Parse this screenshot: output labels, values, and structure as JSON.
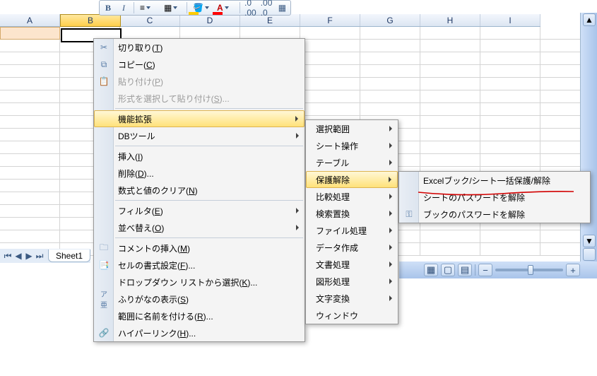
{
  "columns": [
    "A",
    "B",
    "C",
    "D",
    "E",
    "F",
    "G",
    "H",
    "I"
  ],
  "toolbar": {
    "bold": "B",
    "italic": "I",
    "increase_decimal": ".00",
    "decrease_decimal": ".0"
  },
  "selected_col_header": "B",
  "context_menu": {
    "cut": "切り取り(T)",
    "copy": "コピー(C)",
    "paste": "貼り付け(P)",
    "paste_special": "形式を選択して貼り付け(S)...",
    "extensions": "機能拡張",
    "db_tools": "DBツール",
    "insert": "挿入(I)",
    "delete": "削除(D)...",
    "clear": "数式と値のクリア(N)",
    "filter": "フィルタ(E)",
    "sort": "並べ替え(O)",
    "insert_comment": "コメントの挿入(M)",
    "format_cells": "セルの書式設定(F)...",
    "dropdown": "ドロップダウン リストから選択(K)...",
    "phonetic": "ふりがなの表示(S)",
    "define_name": "範囲に名前を付ける(R)...",
    "hyperlink": "ハイパーリンク(H)..."
  },
  "sub_menu": {
    "selection": "選択範囲",
    "sheet_ops": "シート操作",
    "table": "テーブル",
    "unprotect": "保護解除",
    "compare": "比較処理",
    "search_replace": "検索置換",
    "file_ops": "ファイル処理",
    "data_create": "データ作成",
    "text_proc": "文書処理",
    "shape_proc": "図形処理",
    "char_conv": "文字変換",
    "window": "ウィンドウ"
  },
  "sub_menu2": {
    "batch_protect": "Excelブック/シート一括保護/解除",
    "sheet_pw": "シートのパスワードを解除",
    "book_pw": "ブックのパスワードを解除"
  },
  "sheet_tab": "Sheet1"
}
